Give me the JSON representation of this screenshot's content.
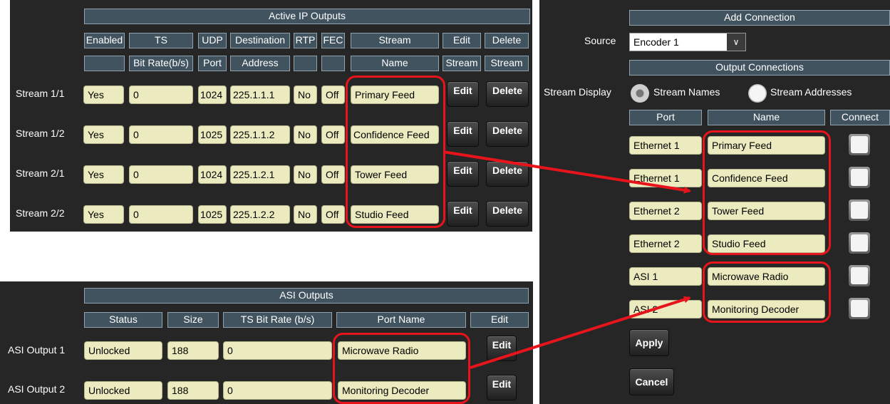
{
  "ip_outputs": {
    "title": "Active IP Outputs",
    "col_header_1": [
      "Enabled",
      "TS",
      "UDP",
      "Destination",
      "RTP",
      "FEC",
      "Stream",
      "Edit",
      "Delete"
    ],
    "col_header_2": [
      "",
      "Bit Rate(b/s)",
      "Port",
      "Address",
      "",
      "",
      "Name",
      "Stream",
      "Stream"
    ],
    "rows": [
      {
        "label": "Stream 1/1",
        "enabled": "Yes",
        "bitrate": "0",
        "port": "1024",
        "address": "225.1.1.1",
        "rtp": "No",
        "fec": "Off",
        "name": "Primary Feed",
        "edit": "Edit",
        "delete": "Delete"
      },
      {
        "label": "Stream 1/2",
        "enabled": "Yes",
        "bitrate": "0",
        "port": "1025",
        "address": "225.1.1.2",
        "rtp": "No",
        "fec": "Off",
        "name": "Confidence Feed",
        "edit": "Edit",
        "delete": "Delete"
      },
      {
        "label": "Stream 2/1",
        "enabled": "Yes",
        "bitrate": "0",
        "port": "1024",
        "address": "225.1.2.1",
        "rtp": "No",
        "fec": "Off",
        "name": "Tower Feed",
        "edit": "Edit",
        "delete": "Delete"
      },
      {
        "label": "Stream 2/2",
        "enabled": "Yes",
        "bitrate": "0",
        "port": "1025",
        "address": "225.1.2.2",
        "rtp": "No",
        "fec": "Off",
        "name": "Studio Feed",
        "edit": "Edit",
        "delete": "Delete"
      }
    ]
  },
  "asi_outputs": {
    "title": "ASI Outputs",
    "col_headers": [
      "Status",
      "Size",
      "TS Bit Rate (b/s)",
      "Port Name",
      "Edit"
    ],
    "rows": [
      {
        "label": "ASI Output 1",
        "status": "Unlocked",
        "size": "188",
        "bitrate": "0",
        "port_name": "Microwave Radio",
        "edit": "Edit"
      },
      {
        "label": "ASI Output 2",
        "status": "Unlocked",
        "size": "188",
        "bitrate": "0",
        "port_name": "Monitoring Decoder",
        "edit": "Edit"
      }
    ]
  },
  "add_connection": {
    "title": "Add Connection",
    "source_label": "Source",
    "source_value": "Encoder 1",
    "output_connections_title": "Output Connections",
    "stream_display_label": "Stream Display",
    "radio_names": "Stream Names",
    "radio_addresses": "Stream Addresses",
    "col_headers": [
      "Port",
      "Name",
      "Connect"
    ],
    "rows": [
      {
        "port": "Ethernet 1",
        "name": "Primary Feed"
      },
      {
        "port": "Ethernet 1",
        "name": "Confidence Feed"
      },
      {
        "port": "Ethernet 2",
        "name": "Tower Feed"
      },
      {
        "port": "Ethernet 2",
        "name": "Studio Feed"
      },
      {
        "port": "ASI 1",
        "name": "Microwave Radio"
      },
      {
        "port": "ASI 2",
        "name": "Monitoring Decoder"
      }
    ],
    "apply_label": "Apply",
    "cancel_label": "Cancel"
  },
  "colors": {
    "panel_bg": "#262626",
    "header_bg": "#40535f",
    "field_bg": "#ecebbf",
    "highlight": "#e8141c"
  }
}
